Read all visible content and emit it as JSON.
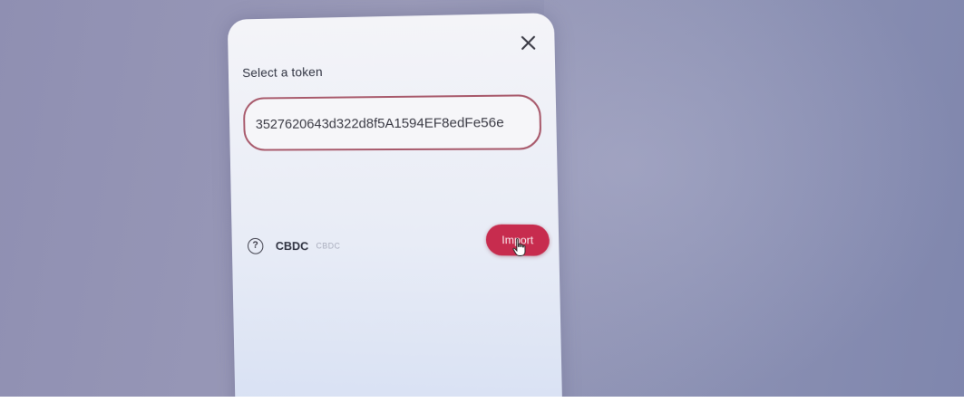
{
  "dialog": {
    "title": "Select a token",
    "close_icon": "close-icon"
  },
  "search": {
    "value": "3527620643d322d8f5A1594EF8edFe56e"
  },
  "token": {
    "help_icon": "question-circle-icon",
    "help_glyph": "?",
    "name": "CBDC",
    "symbol": "CBDC",
    "import_label": "Import"
  },
  "colors": {
    "accent": "#c72c4e",
    "input_border": "#a8596b",
    "backdrop": "#9a9ab8"
  }
}
